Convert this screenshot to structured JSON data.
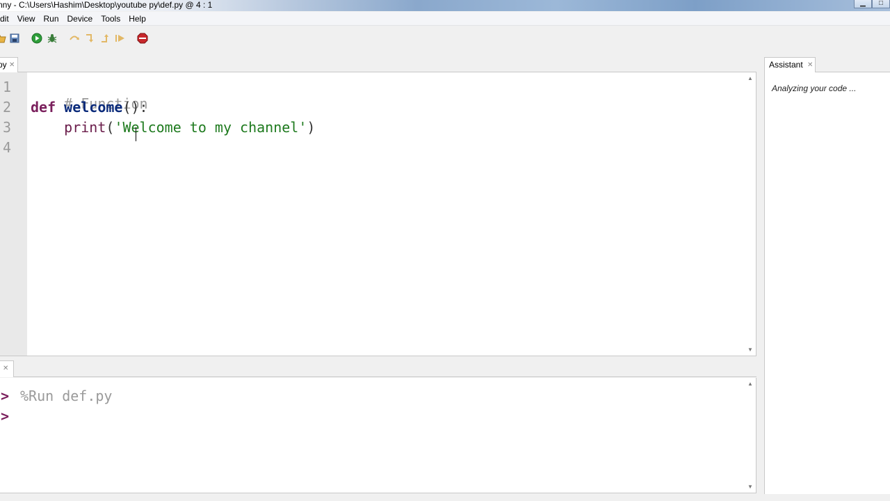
{
  "window": {
    "title": "nny  -  C:\\Users\\Hashim\\Desktop\\youtube py\\def.py  @  4 : 1"
  },
  "menu": {
    "items": [
      "dit",
      "View",
      "Run",
      "Device",
      "Tools",
      "Help"
    ]
  },
  "toolbar": {
    "icons": [
      "open-file-icon",
      "save-icon",
      "run-icon",
      "debug-icon",
      "step-over-icon",
      "step-into-icon",
      "step-out-icon",
      "resume-icon",
      "stop-icon"
    ],
    "run_color": "#2e9e3a",
    "stop_color": "#c8282c"
  },
  "editor": {
    "tab_label": "py",
    "line_numbers": [
      "1",
      "2",
      "3",
      "4"
    ],
    "lines": {
      "l1_comment": "# Function",
      "l2_kw": "def",
      "l2_fn": "welcome",
      "l2_rest": "():",
      "l3_indent": "    ",
      "l3_name": "print",
      "l3_open": "(",
      "l3_str": "'Welcome to my channel'",
      "l3_close": ")"
    }
  },
  "shell": {
    "prompt": ">",
    "command": "%Run def.py"
  },
  "assistant": {
    "tab_label": "Assistant",
    "status": "Analyzing your code ..."
  }
}
